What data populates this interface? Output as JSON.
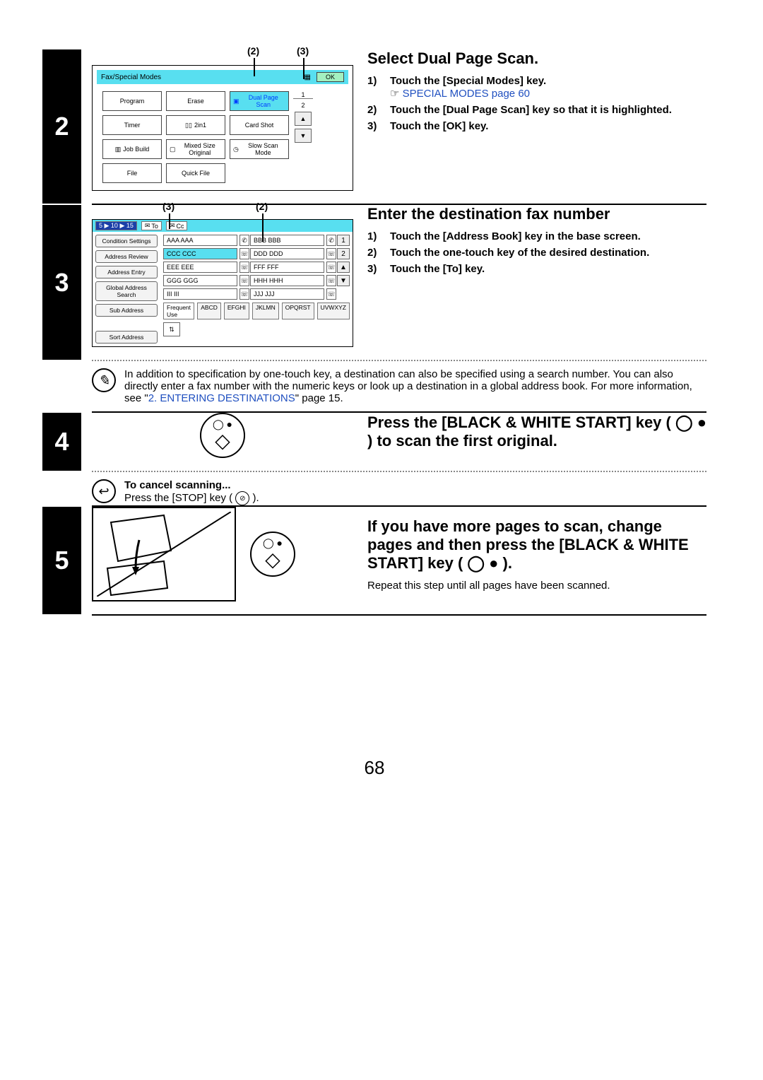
{
  "page_number": "68",
  "step2": {
    "num": "2",
    "callouts": [
      "(2)",
      "(3)"
    ],
    "panel_title": "Fax/Special Modes",
    "ok": "OK",
    "buttons": {
      "program": "Program",
      "erase": "Erase",
      "dual": "Dual Page Scan",
      "timer": "Timer",
      "twoin1": "2in1",
      "cardshot": "Card Shot",
      "jobbuild": "Job Build",
      "mixed": "Mixed Size Original",
      "slow": "Slow Scan Mode",
      "file": "File",
      "quick": "Quick File"
    },
    "pager": [
      "1",
      "2"
    ],
    "title": "Select Dual Page Scan.",
    "items": [
      {
        "n": "1)",
        "t": "Touch the [Special Modes] key.",
        "link_pointer": "☞",
        "link": "SPECIAL MODES",
        "link_after": " page 60"
      },
      {
        "n": "2)",
        "t": "Touch the [Dual Page Scan] key so that it is highlighted."
      },
      {
        "n": "3)",
        "t": "Touch the [OK] key."
      }
    ]
  },
  "step3": {
    "num": "3",
    "callouts": [
      "(3)",
      "(2)"
    ],
    "top": {
      "range": "5 ▶ 10 ▶ 15",
      "to": "To",
      "cc": "Cc"
    },
    "left": [
      "Condition Settings",
      "Address Review",
      "Address Entry",
      "Global Address Search",
      "Sub Address",
      "",
      "Sort Address"
    ],
    "rows": [
      [
        "AAA AAA",
        "BBB BBB"
      ],
      [
        "CCC CCC",
        "DDD DDD"
      ],
      [
        "EEE EEE",
        "FFF FFF"
      ],
      [
        "GGG GGG",
        "HHH HHH"
      ],
      [
        "III III",
        "JJJ JJJ"
      ]
    ],
    "pager": [
      "1",
      "2"
    ],
    "tabs": [
      "Frequent Use",
      "ABCD",
      "EFGHI",
      "JKLMN",
      "OPQRST",
      "UVWXYZ"
    ],
    "title": "Enter the destination fax number",
    "items": [
      {
        "n": "1)",
        "t": "Touch the [Address Book] key in the base screen."
      },
      {
        "n": "2)",
        "t": "Touch the one-touch key of the desired destination."
      },
      {
        "n": "3)",
        "t": "Touch the [To] key."
      }
    ],
    "note": "In addition to specification by one-touch key, a destination can also be specified using a search number. You can also directly enter a fax number with the numeric keys or look up a destination in a global address book. For more information, see \"",
    "note_link": "2. ENTERING DESTINATIONS",
    "note_after": "\" page 15."
  },
  "step4": {
    "num": "4",
    "title": "Press the [BLACK & WHITE START] key ( ◯ ● ) to scan the first original.",
    "cancel_title": "To cancel scanning...",
    "cancel_text": "Press the [STOP] key ( "
  },
  "step5": {
    "num": "5",
    "title": "If you have more pages to scan, change pages and then press the [BLACK & WHITE START] key ( ◯ ● ).",
    "sub": "Repeat this step until all pages have been scanned."
  }
}
